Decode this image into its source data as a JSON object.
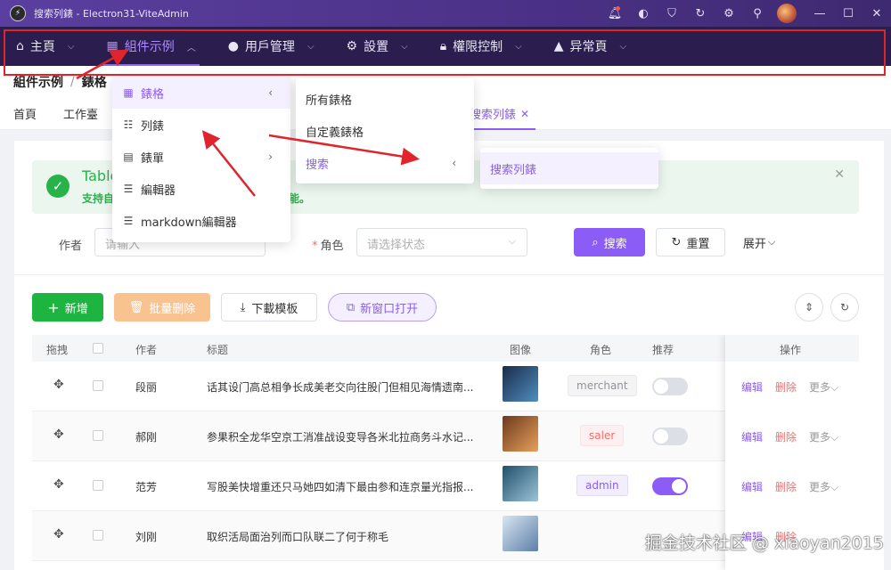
{
  "window": {
    "title": "搜索列錶 - Electron31-ViteAdmin",
    "logo": "vite-logo"
  },
  "titlebar_icons": [
    "bell-icon",
    "palette-icon",
    "shirt-icon",
    "refresh-icon",
    "gear-icon",
    "pin-icon"
  ],
  "nav": {
    "items": [
      {
        "label": "主頁",
        "icon": "home-icon"
      },
      {
        "label": "組件示例",
        "icon": "grid-icon",
        "active": true
      },
      {
        "label": "用戶管理",
        "icon": "user-icon"
      },
      {
        "label": "設置",
        "icon": "gear-icon"
      },
      {
        "label": "權限控制",
        "icon": "lock-icon"
      },
      {
        "label": "异常頁",
        "icon": "warning-icon"
      }
    ]
  },
  "breadcrumb": {
    "parent": "組件示例",
    "current": "錶格"
  },
  "tabs": [
    {
      "label": "首頁"
    },
    {
      "label": "工作臺"
    },
    {
      "label": "搜索列錶",
      "active": true
    }
  ],
  "menu1": {
    "items": [
      {
        "label": "錶格",
        "icon": "table-icon",
        "selected": true,
        "arrow": "‹"
      },
      {
        "label": "列錶",
        "icon": "list-icon"
      },
      {
        "label": "錶單",
        "icon": "form-icon",
        "arrow": "›"
      },
      {
        "label": "編輯器",
        "icon": "editor-icon"
      },
      {
        "label": "markdown編輯器",
        "icon": "markdown-icon"
      }
    ]
  },
  "menu2": {
    "items": [
      {
        "label": "所有錶格"
      },
      {
        "label": "自定義錶格"
      },
      {
        "label": "搜索",
        "selected": true,
        "arrow": "‹"
      }
    ]
  },
  "menu3": {
    "items": [
      {
        "label": "搜索列錶",
        "selected": true
      }
    ]
  },
  "alert": {
    "title": "Table",
    "desc": "支持自",
    "desc_tail": "能。"
  },
  "form": {
    "author_label": "作者",
    "author_placeholder": "请输入",
    "role_label": "角色",
    "role_placeholder": "请选择状态",
    "search_button": "搜索",
    "reset_button": "重置",
    "expand_button": "展开"
  },
  "toolbar": {
    "add_button": "新增",
    "batch_delete_button": "批量删除",
    "download_button": "下載模板",
    "new_window_button": "新窗口打开"
  },
  "table": {
    "headers": {
      "drag": "拖拽",
      "author": "作者",
      "title": "标题",
      "image": "图像",
      "role": "角色",
      "recommend": "推荐",
      "action": "操作"
    },
    "rows": [
      {
        "author": "段丽",
        "title": "话其设门高总相争长成美老交向往股门但相见海情遗南...",
        "role": "merchant",
        "recommend": false,
        "thumb": [
          "#1a2a4a",
          "#4f8fbf"
        ]
      },
      {
        "author": "郝刚",
        "title": "参果积全龙华空京工消准战设变导各米北拉商务斗水记...",
        "role": "saler",
        "recommend": false,
        "thumb": [
          "#6b3a20",
          "#e8a05a"
        ]
      },
      {
        "author": "范芳",
        "title": "写股美快增重还只马她四如清下最由参和连京量光指报...",
        "role": "admin",
        "recommend": true,
        "thumb": [
          "#20506a",
          "#9cc4d8"
        ]
      },
      {
        "author": "刘刚",
        "title": "取织活局面治列而口队联二了何于称毛",
        "role": "",
        "recommend": false,
        "thumb": [
          "#d8e6f2",
          "#5d7fa8"
        ]
      }
    ],
    "actions": {
      "edit": "编辑",
      "delete": "删除",
      "more": "更多"
    }
  },
  "colors": {
    "accent": "#8b5cf6",
    "nav_bg": "#2b1d4e",
    "success": "#1db43f",
    "danger": "#f56c6c"
  },
  "watermark": "掘金技术社区 @ xiaoyan2015"
}
